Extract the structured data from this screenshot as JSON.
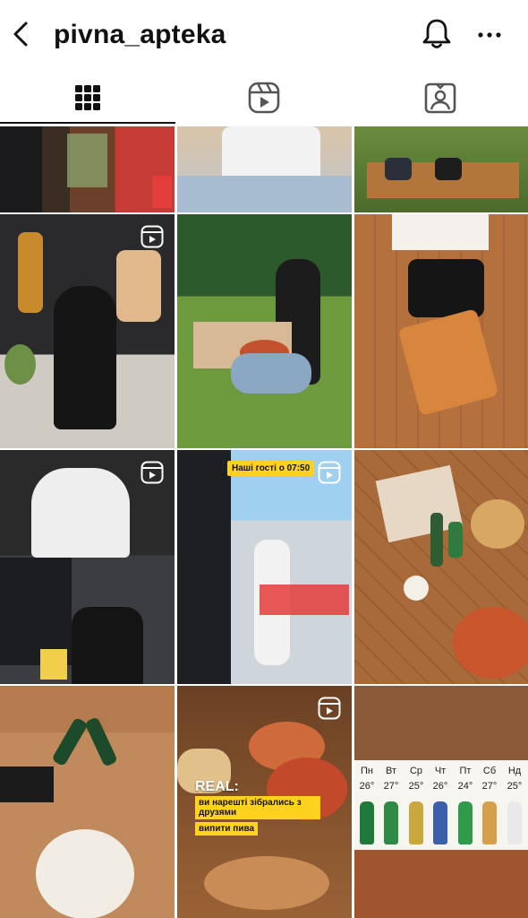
{
  "header": {
    "title": "pivna_apteka",
    "back_icon": "chevron-left-icon",
    "notification_icon": "bell-icon",
    "more_icon": "ellipsis-horizontal-icon"
  },
  "tabs": [
    {
      "name": "posts-grid",
      "icon": "grid-icon",
      "active": true
    },
    {
      "name": "reels",
      "icon": "reels-icon",
      "active": false
    },
    {
      "name": "tagged",
      "icon": "tagged-person-icon",
      "active": false
    }
  ],
  "overlays": {
    "guests_tag": "Наші гості о 07:50",
    "real_word": "REAL:",
    "real_line1": "ви нарешті зібрались з друзями",
    "real_line2": "випити пива"
  },
  "weather": {
    "days": [
      {
        "day": "Пн",
        "temp": "26°"
      },
      {
        "day": "Вт",
        "temp": "27°"
      },
      {
        "day": "Ср",
        "temp": "25°"
      },
      {
        "day": "Чт",
        "temp": "26°"
      },
      {
        "day": "Пт",
        "temp": "24°"
      },
      {
        "day": "Сб",
        "temp": "27°"
      },
      {
        "day": "Нд",
        "temp": "25°"
      }
    ]
  },
  "colors": {
    "accent_yellow": "#ffd21f",
    "icon_dark": "#111111",
    "icon_gray": "#555555"
  }
}
